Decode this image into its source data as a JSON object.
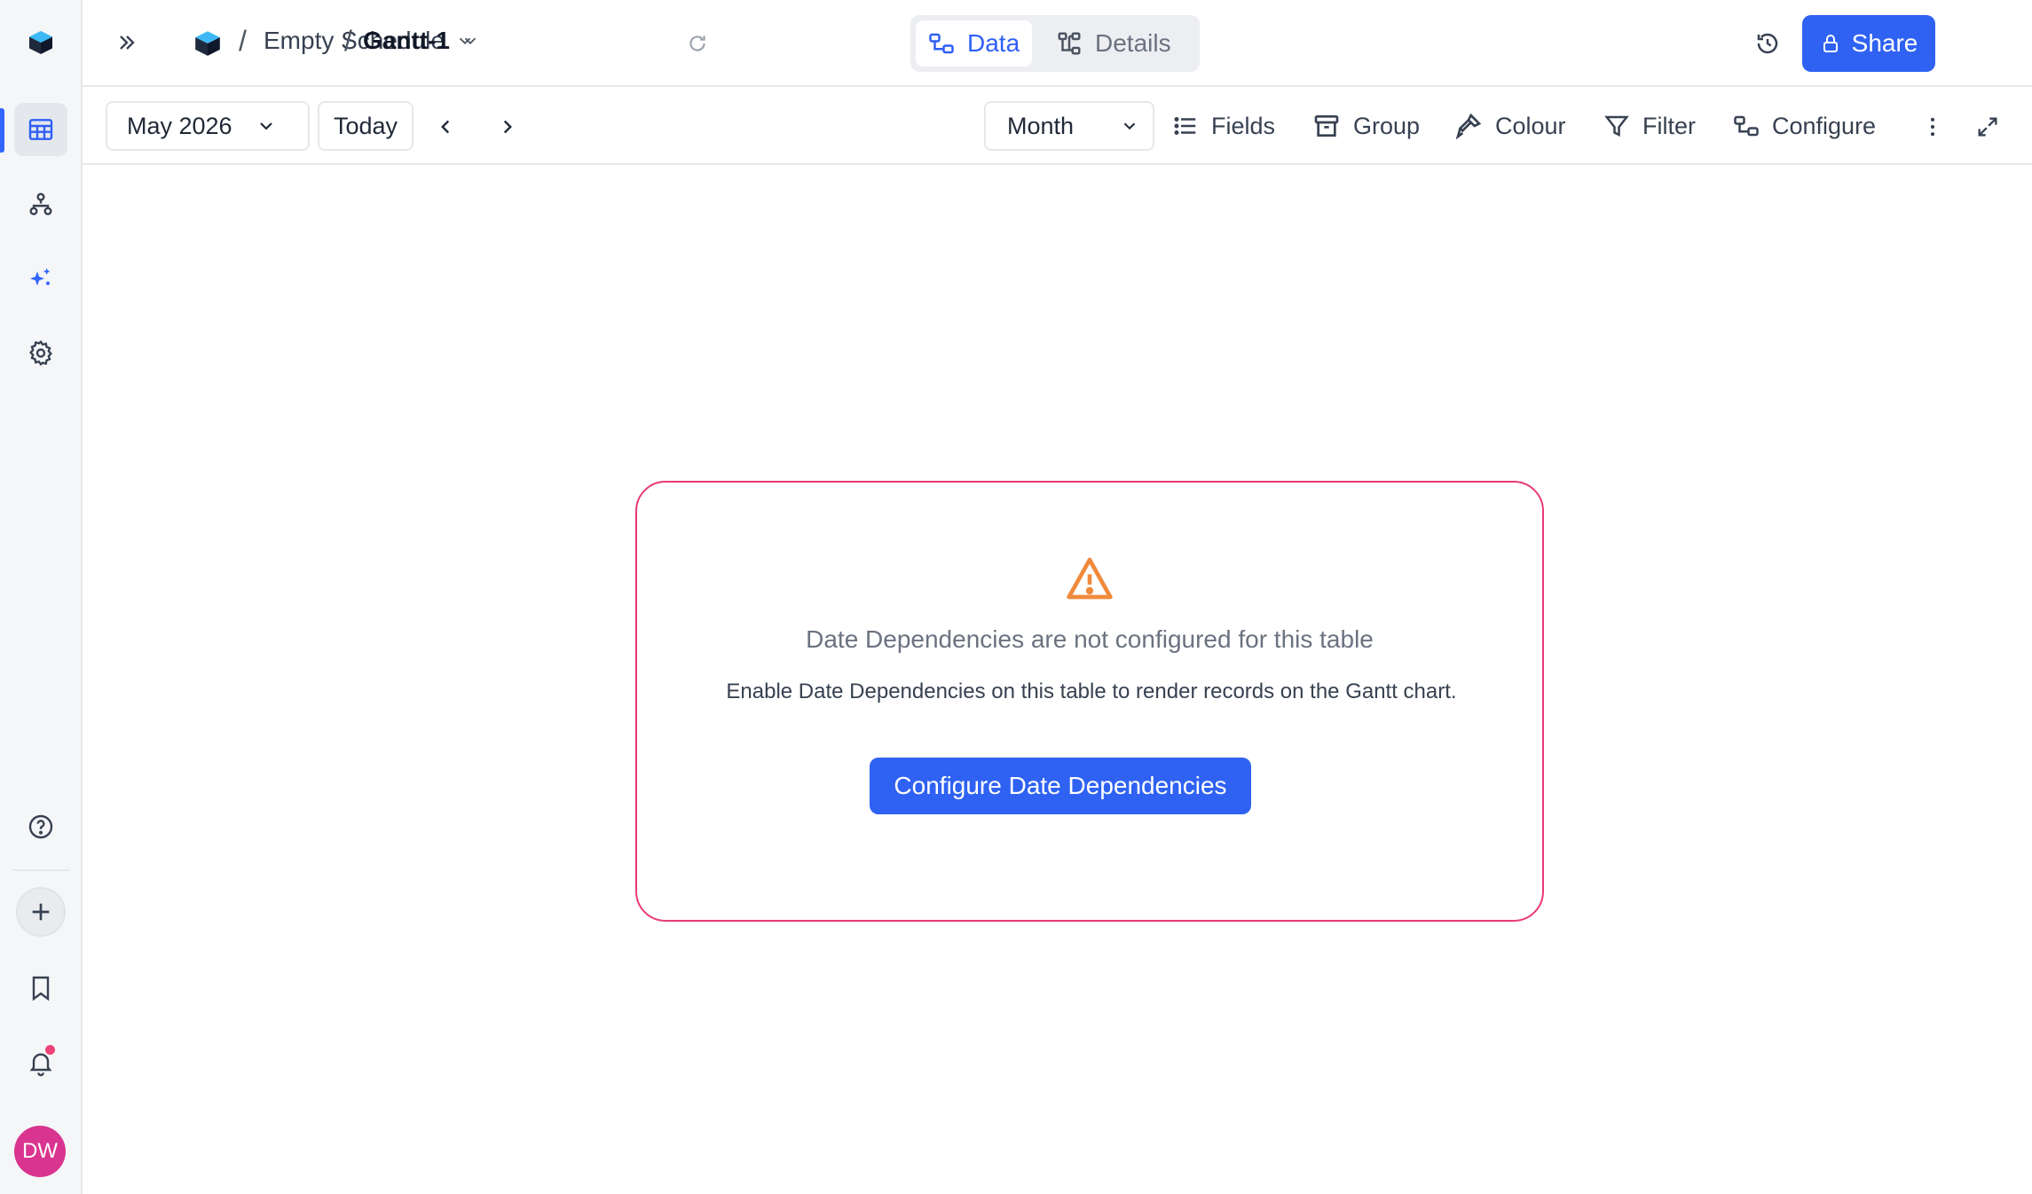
{
  "sidebar": {
    "icons": [
      "app-logo-icon",
      "grid-icon",
      "hierarchy-icon",
      "sparkles-icon",
      "gear-icon",
      "help-icon",
      "plus-icon",
      "bookmark-icon",
      "bell-icon"
    ],
    "avatar_initials": "DW",
    "accent_color": "#3366ff",
    "avatar_color": "#d9348f"
  },
  "topbar": {
    "breadcrumb": {
      "separator": "/",
      "workspace": "Empty Schedule",
      "view": "Gantt-1"
    },
    "segments": {
      "data_label": "Data",
      "details_label": "Details",
      "active": "Data"
    },
    "share_label": "Share"
  },
  "toolbar": {
    "date_selector": "May 2026",
    "today_label": "Today",
    "scale_selector": "Month",
    "fields_label": "Fields",
    "group_label": "Group",
    "colour_label": "Colour",
    "filter_label": "Filter",
    "configure_label": "Configure"
  },
  "notice": {
    "title": "Date Dependencies are not configured for this table",
    "description": "Enable Date Dependencies on this table to render records on the Gantt chart.",
    "button_label": "Configure Date Dependencies",
    "border_color": "#e8397a",
    "warning_color": "#f08a3c"
  },
  "colors": {
    "primary": "#2f62f2"
  }
}
